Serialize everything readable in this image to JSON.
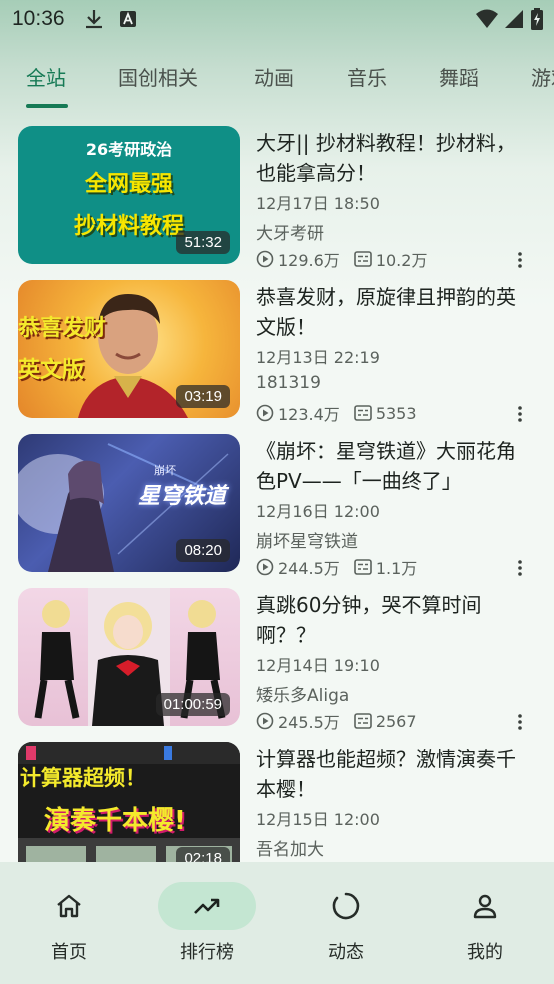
{
  "status_bar": {
    "time": "10:36"
  },
  "tabs": [
    "全站",
    "国创相关",
    "动画",
    "音乐",
    "舞蹈",
    "游戏"
  ],
  "videos": [
    {
      "title": "大牙|| 抄材料教程！抄材料，也能拿高分！",
      "date": "12月17日 18:50",
      "author": "大牙考研",
      "views": "129.6万",
      "danmaku": "10.2万",
      "duration": "51:32",
      "thumb_text": [
        "26考研政治",
        "全网最强",
        "抄材料教程"
      ]
    },
    {
      "title": "恭喜发财，原旋律且押韵的英文版！",
      "date": "12月13日 22:19",
      "author": "181319",
      "views": "123.4万",
      "danmaku": "5353",
      "duration": "03:19",
      "thumb_text": [
        "恭喜发财",
        "英文版"
      ]
    },
    {
      "title": "《崩坏：星穹铁道》大丽花角色PV——「一曲终了」",
      "date": "12月16日 12:00",
      "author": "崩坏星穹铁道",
      "views": "244.5万",
      "danmaku": "1.1万",
      "duration": "08:20",
      "thumb_text": [
        "崩坏",
        "星穹铁道"
      ]
    },
    {
      "title": "真跳60分钟，哭不算时间啊？？",
      "date": "12月14日 19:10",
      "author": "矮乐多Aliga",
      "views": "245.5万",
      "danmaku": "2567",
      "duration": "01:00:59",
      "thumb_text": []
    },
    {
      "title": "计算器也能超频？激情演奏千本樱！",
      "date": "12月15日 12:00",
      "author": "吾名加大",
      "views": "",
      "danmaku": "",
      "duration": "02:18",
      "thumb_text": [
        "计算器超频！",
        "演奏千本樱!"
      ]
    }
  ],
  "bottom_nav": [
    "首页",
    "排行榜",
    "动态",
    "我的"
  ],
  "colors": {
    "accent": "#167a55",
    "nav_active_bg": "#c4e6d2"
  }
}
